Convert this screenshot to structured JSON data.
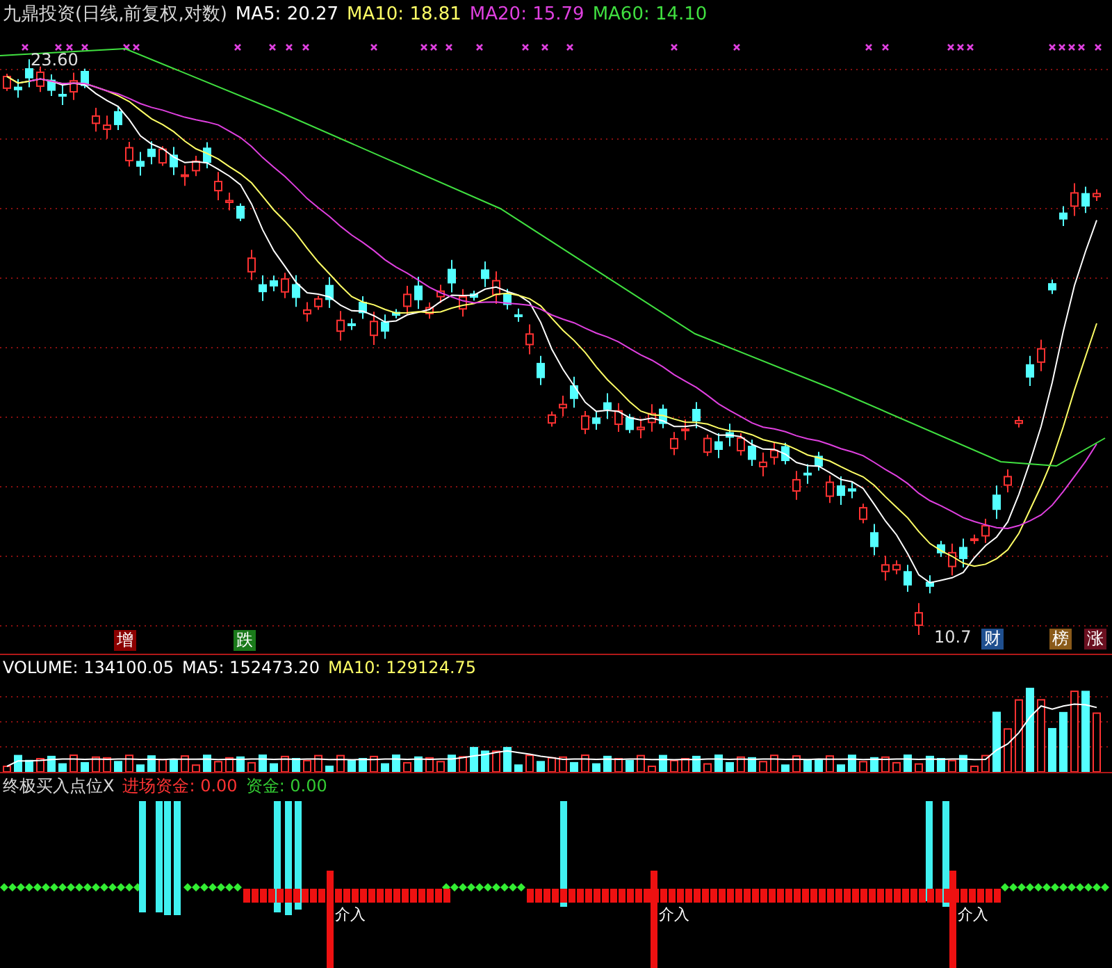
{
  "main": {
    "title": "九鼎投资(日线,前复权,对数)",
    "indicators": [
      {
        "label": "MA5: 20.27",
        "color": "#ffffff"
      },
      {
        "label": "MA10: 18.81",
        "color": "#ffff66"
      },
      {
        "label": "MA20: 15.79",
        "color": "#e040e0"
      },
      {
        "label": "MA60: 14.10",
        "color": "#40e040"
      }
    ],
    "high_label": "23.60",
    "low_label": "10.7",
    "badges": [
      {
        "text": "增",
        "color": "#8b0000"
      },
      {
        "text": "跌",
        "color": "#1a7a1a"
      },
      {
        "text": "财",
        "color": "#1f4f8f"
      },
      {
        "text": "榜",
        "color": "#8a5a1a"
      },
      {
        "text": "涨",
        "color": "#6a1020"
      }
    ]
  },
  "volume": {
    "indicators": [
      {
        "label": "VOLUME: 134100.05",
        "color": "#ffffff"
      },
      {
        "label": "MA5: 152473.20",
        "color": "#ffffff"
      },
      {
        "label": "MA10: 129124.75",
        "color": "#ffff66"
      }
    ]
  },
  "signal": {
    "title": "终极买入点位X",
    "indicators": [
      {
        "label": "进场资金: 0.00",
        "color": "#ff3333"
      },
      {
        "label": "资金: 0.00",
        "color": "#33cc33"
      }
    ],
    "markers": [
      "介入",
      "介入",
      "介入"
    ]
  }
}
